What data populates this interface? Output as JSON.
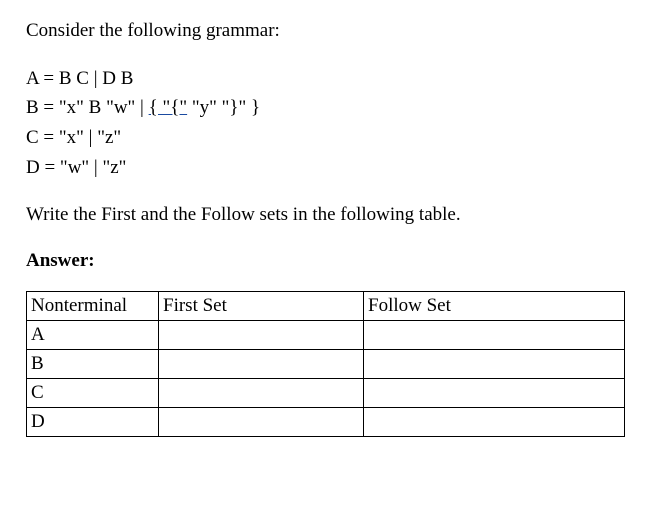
{
  "intro": "Consider the following grammar:",
  "grammar": {
    "lineA": "A = B C | D B",
    "lineB_prefix": "B = \"x\" B \"w\" | ",
    "lineB_underlined": "{ \"{\"",
    "lineB_suffix": "  \"y\"   \"}\" }",
    "lineC": "C = \"x\" | \"z\"",
    "lineD": "D = \"w\" | \"z\""
  },
  "task": "Write the First and the Follow sets in the following table.",
  "answer_label": "Answer:",
  "table": {
    "headers": {
      "nonterminal": "Nonterminal",
      "first": "First Set",
      "follow": "Follow Set"
    },
    "rows": [
      {
        "nt": "A",
        "first": "",
        "follow": ""
      },
      {
        "nt": "B",
        "first": "",
        "follow": ""
      },
      {
        "nt": "C",
        "first": "",
        "follow": ""
      },
      {
        "nt": "D",
        "first": "",
        "follow": ""
      }
    ]
  }
}
